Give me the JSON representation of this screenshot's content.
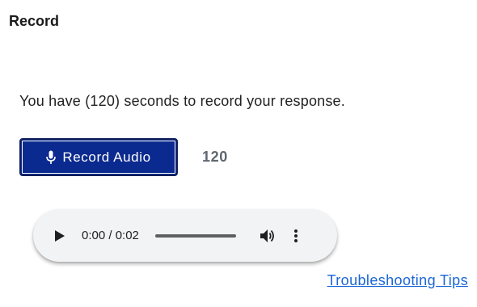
{
  "section": {
    "title": "Record"
  },
  "instruction": "You have (120) seconds to record your response.",
  "recorder": {
    "button_label": "Record Audio",
    "button_icon": "microphone-icon",
    "countdown": "120",
    "colors": {
      "button_bg": "#0b2a8f",
      "countdown_text": "#5f6770"
    }
  },
  "audio_player": {
    "time": "0:00 / 0:02",
    "progress": 0,
    "icons": {
      "play": "play-icon",
      "volume": "volume-icon",
      "more": "more-options-icon"
    }
  },
  "link": {
    "troubleshooting": "Troubleshooting Tips",
    "color": "#1a66d6"
  }
}
